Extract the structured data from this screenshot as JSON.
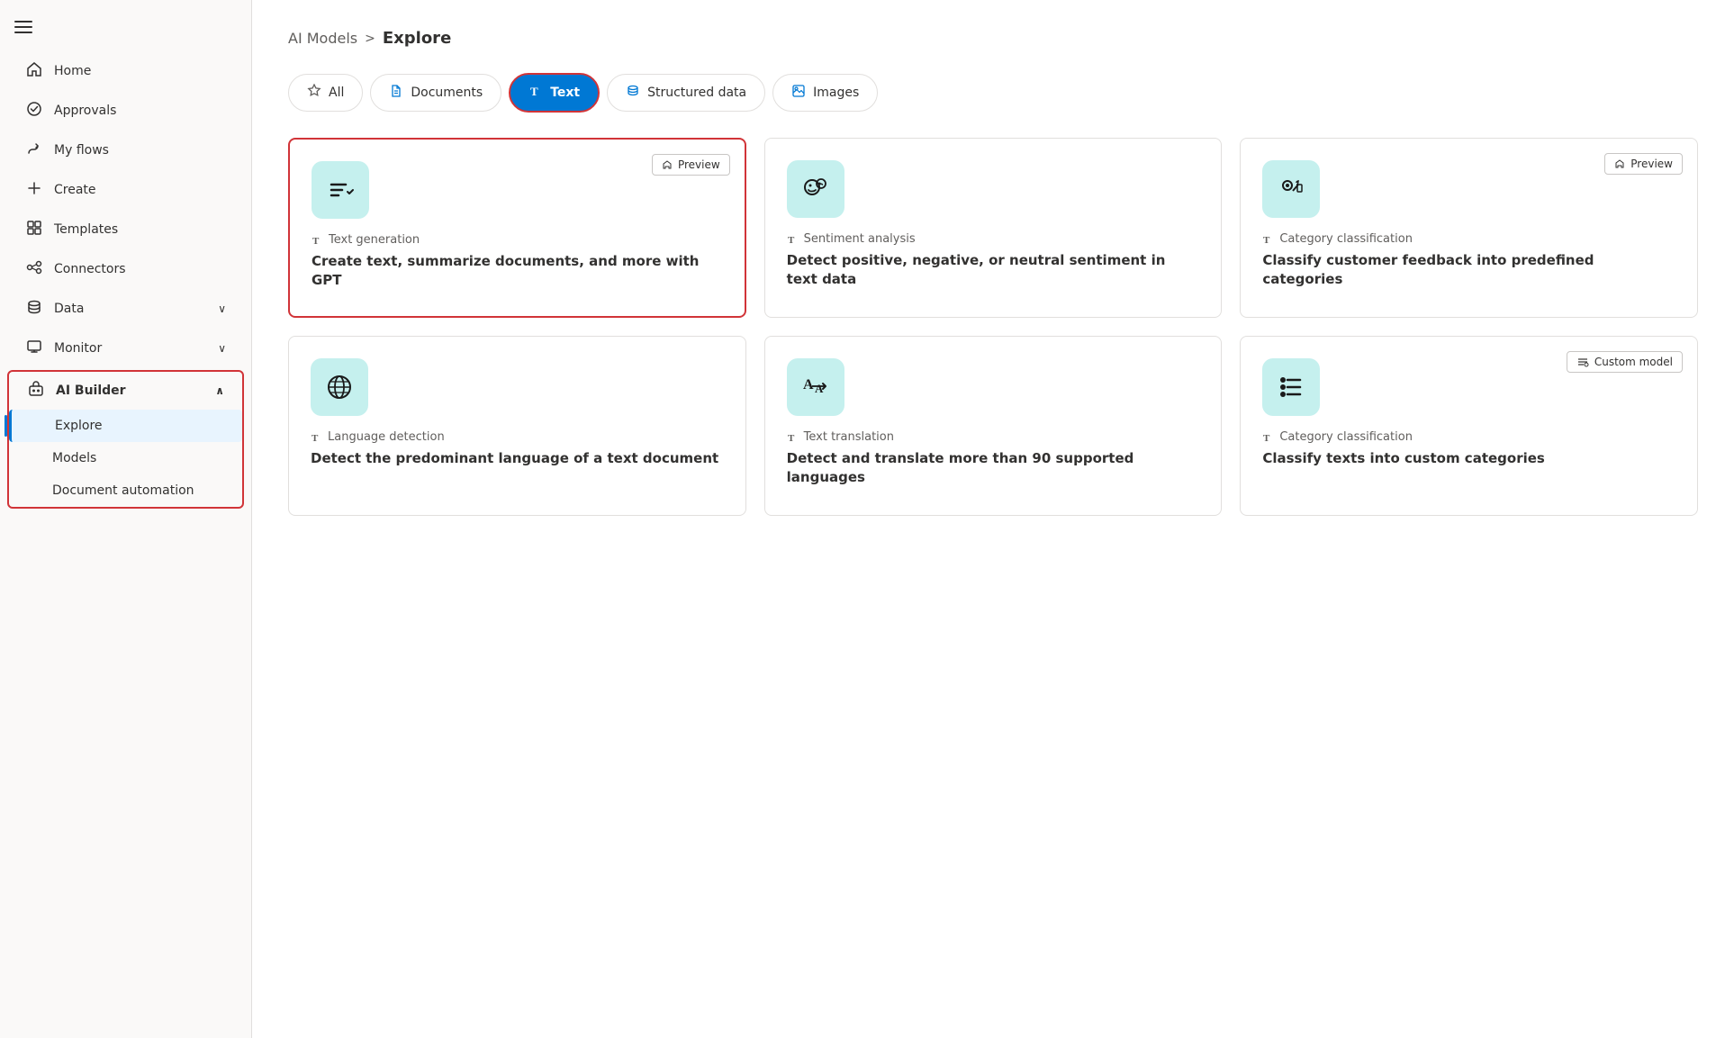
{
  "sidebar": {
    "items": [
      {
        "id": "home",
        "label": "Home",
        "icon": "🏠",
        "hasChevron": false
      },
      {
        "id": "approvals",
        "label": "Approvals",
        "icon": "✓",
        "hasChevron": false
      },
      {
        "id": "my-flows",
        "label": "My flows",
        "icon": "↗",
        "hasChevron": false
      },
      {
        "id": "create",
        "label": "Create",
        "icon": "+",
        "hasChevron": false
      },
      {
        "id": "templates",
        "label": "Templates",
        "icon": "⊞",
        "hasChevron": false
      },
      {
        "id": "connectors",
        "label": "Connectors",
        "icon": "🔗",
        "hasChevron": false
      },
      {
        "id": "data",
        "label": "Data",
        "icon": "🗄",
        "hasChevron": true
      },
      {
        "id": "monitor",
        "label": "Monitor",
        "icon": "📊",
        "hasChevron": true
      },
      {
        "id": "ai-builder",
        "label": "AI Builder",
        "icon": "🤖",
        "hasChevron": true,
        "expanded": true
      },
      {
        "id": "explore",
        "label": "Explore",
        "sub": true,
        "active": true
      },
      {
        "id": "models",
        "label": "Models",
        "sub": true
      },
      {
        "id": "document-automation",
        "label": "Document automation",
        "sub": true
      }
    ]
  },
  "breadcrumb": {
    "parent": "AI Models",
    "separator": ">",
    "current": "Explore"
  },
  "tabs": [
    {
      "id": "all",
      "label": "All",
      "icon": "star",
      "active": false
    },
    {
      "id": "documents",
      "label": "Documents",
      "icon": "doc",
      "active": false
    },
    {
      "id": "text",
      "label": "Text",
      "icon": "T",
      "active": true
    },
    {
      "id": "structured-data",
      "label": "Structured data",
      "icon": "db",
      "active": false
    },
    {
      "id": "images",
      "label": "Images",
      "icon": "img",
      "active": false
    }
  ],
  "cards": [
    {
      "id": "text-generation",
      "type": "Text generation",
      "title": "Create text, summarize documents, and more with GPT",
      "badge": "Preview",
      "selected": true
    },
    {
      "id": "sentiment-analysis",
      "type": "Sentiment analysis",
      "title": "Detect positive, negative, or neutral sentiment in text data",
      "badge": null,
      "selected": false
    },
    {
      "id": "category-classification-1",
      "type": "Category classification",
      "title": "Classify customer feedback into predefined categories",
      "badge": "Preview",
      "selected": false
    },
    {
      "id": "language-detection",
      "type": "Language detection",
      "title": "Detect the predominant language of a text document",
      "badge": null,
      "selected": false
    },
    {
      "id": "text-translation",
      "type": "Text translation",
      "title": "Detect and translate more than 90 supported languages",
      "badge": null,
      "selected": false
    },
    {
      "id": "category-classification-2",
      "type": "Category classification",
      "title": "Classify texts into custom categories",
      "badge": "Custom model",
      "selected": false
    }
  ],
  "icons": {
    "hamburger": "☰",
    "home": "⌂",
    "approvals": "✔",
    "flows": "⤴",
    "create": "+",
    "templates": "⊞",
    "connectors": "⊕",
    "data": "🗄",
    "monitor": "📈",
    "ai": "🤖",
    "chevron_down": "∨",
    "chevron_up": "∧",
    "star": "☆",
    "doc": "📄",
    "text_T": "T",
    "db": "🗃",
    "img": "🖼",
    "preview_flag": "⚑",
    "custom_model": "≡",
    "type_T": "T"
  }
}
